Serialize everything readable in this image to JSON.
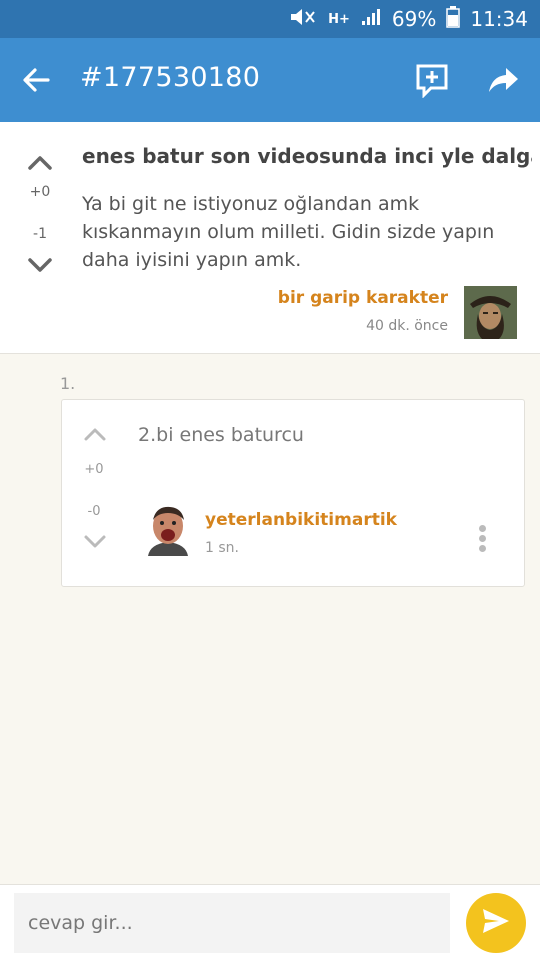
{
  "status_bar": {
    "network": "H+",
    "battery": "69%",
    "time": "11:34"
  },
  "app_bar": {
    "title": "#177530180"
  },
  "post": {
    "title": "enes batur son videosunda inci yle dalga...",
    "body": "Ya bi git ne istiyonuz oğlandan amk kıskanmayın olum milleti. Gidin sizde yapın daha iyisini yapın amk.",
    "upvotes": "+0",
    "downvotes": "-1",
    "author": "bir garip karakter",
    "time": "40 dk. önce"
  },
  "thread": {
    "number": "1.",
    "reply": {
      "text": "2.bi enes baturcu",
      "upvotes": "+0",
      "downvotes": "-0",
      "author": "yeterlanbikitimartik",
      "time": "1 sn."
    }
  },
  "composer": {
    "placeholder": "cevap gir..."
  },
  "icons": {
    "back": "arrow-left-icon",
    "reply": "add-comment-icon",
    "share": "share-icon",
    "send": "send-icon"
  },
  "colors": {
    "app_bar": "#3e8ed0",
    "status_bar": "#2f74b0",
    "author": "#d5841d",
    "send": "#f3c31e"
  }
}
